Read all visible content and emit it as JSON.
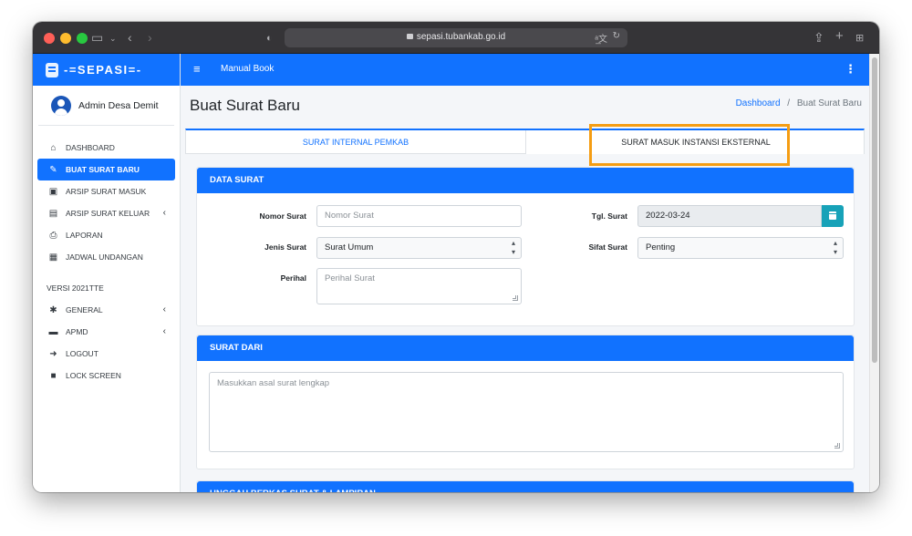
{
  "browser": {
    "url": "sepasi.tubankab.go.id",
    "translate_label": "ᵃ̲文",
    "reload_label": "↻"
  },
  "brand": {
    "name": "-=SEPASI=-"
  },
  "user": {
    "name": "Admin Desa Demit"
  },
  "sidebar": {
    "items": [
      {
        "label": "DASHBOARD",
        "icon": "home-icon"
      },
      {
        "label": "BUAT SURAT BARU",
        "icon": "edit-icon"
      },
      {
        "label": "ARSIP SURAT MASUK",
        "icon": "inbox-icon"
      },
      {
        "label": "ARSIP SURAT KELUAR",
        "icon": "outbox-icon",
        "caret": "‹"
      },
      {
        "label": "LAPORAN",
        "icon": "print-icon"
      },
      {
        "label": "JADWAL UNDANGAN",
        "icon": "calendar-icon"
      }
    ],
    "section_header": "VERSI 2021TTE",
    "items2": [
      {
        "label": "GENERAL",
        "icon": "cog-icon",
        "caret": "‹"
      },
      {
        "label": "APMD",
        "icon": "id-card-icon",
        "caret": "‹"
      },
      {
        "label": "LOGOUT",
        "icon": "sign-out-icon"
      },
      {
        "label": "LOCK SCREEN",
        "icon": "lock-icon"
      }
    ]
  },
  "topnav": {
    "manual": "Manual Book"
  },
  "page": {
    "title": "Buat Surat Baru",
    "breadcrumb_home": "Dashboard",
    "breadcrumb_sep": "/",
    "breadcrumb_current": "Buat Surat Baru"
  },
  "tabs": [
    {
      "label": "SURAT INTERNAL PEMKAB"
    },
    {
      "label": "SURAT MASUK INSTANSI EKSTERNAL"
    }
  ],
  "data_surat": {
    "header": "DATA SURAT",
    "nomor_label": "Nomor Surat",
    "nomor_placeholder": "Nomor Surat",
    "jenis_label": "Jenis Surat",
    "jenis_value": "Surat Umum",
    "perihal_label": "Perihal",
    "perihal_placeholder": "Perihal Surat",
    "tgl_label": "Tgl. Surat",
    "tgl_value": "2022-03-24",
    "sifat_label": "Sifat Surat",
    "sifat_value": "Penting"
  },
  "surat_dari": {
    "header": "SURAT DARI",
    "placeholder": "Masukkan asal surat lengkap"
  },
  "unggah": {
    "header": "UNGGAH BERKAS SURAT & LAMPIRAN"
  }
}
